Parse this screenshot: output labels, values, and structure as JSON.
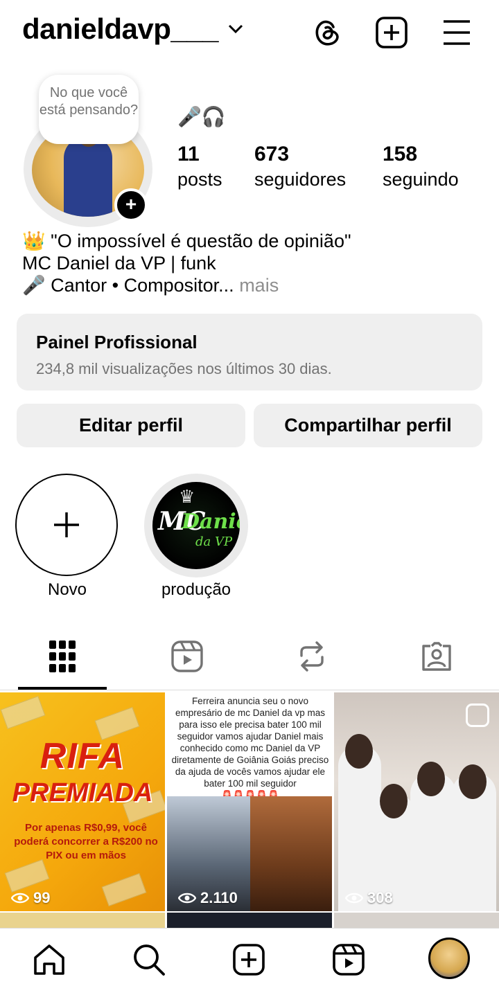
{
  "header": {
    "username": "danieldavp___"
  },
  "profile": {
    "thought_bubble": "No que você está pensando?",
    "emoji_line": "🎤🎧",
    "stats": [
      {
        "value": "11",
        "label": "posts"
      },
      {
        "value": "673",
        "label": "seguidores"
      },
      {
        "value": "158",
        "label": "seguindo"
      }
    ],
    "bio": {
      "line1": "👑 \"O impossível é questão de opinião\"",
      "line2": "MC Daniel da VP | funk",
      "line3": "🎤 Cantor • Compositor...",
      "more": " mais"
    }
  },
  "panel": {
    "title": "Painel Profissional",
    "subtitle": "234,8 mil visualizações nos últimos 30 dias."
  },
  "buttons": {
    "edit": "Editar perfil",
    "share": "Compartilhar perfil"
  },
  "highlights": [
    {
      "label": "Novo"
    },
    {
      "label": "produção",
      "logo_mc": "MC",
      "logo_name": "Daniel",
      "logo_suffix": "da VP"
    }
  ],
  "posts": [
    {
      "views": "99",
      "title1": "RIFA",
      "title2": "PREMIADA",
      "desc": "Por apenas R$0,99, você poderá concorrer a R$200 no PIX ou em mãos"
    },
    {
      "views": "2.110",
      "caption": "Ferreira anuncia seu o novo empresário de mc Daniel da vp mas para isso ele precisa bater 100 mil seguidor vamos ajudar Daniel mais conhecido como mc Daniel da VP diretamente de Goiânia Goiás preciso da ajuda de vocês vamos ajudar ele bater 100 mil seguidor",
      "sirens": "🚨🚨🚨🚨🚨"
    },
    {
      "views": "308"
    }
  ],
  "colors": {
    "accent_gray": "#efefef",
    "muted_text": "#737373",
    "rifa_red": "#d9200f"
  }
}
